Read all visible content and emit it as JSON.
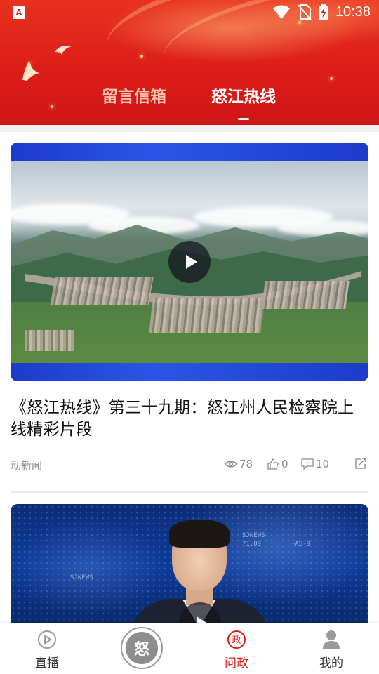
{
  "status_bar": {
    "app_badge": "A",
    "time": "10:38",
    "icons": [
      "wifi-icon",
      "no-sim-icon",
      "battery-charging-icon"
    ]
  },
  "tabs": [
    {
      "label": "留言信箱",
      "active": false
    },
    {
      "label": "怒江热线",
      "active": true
    }
  ],
  "feed": {
    "items": [
      {
        "title": "《怒江热线》第三十九期：怒江州人民检察院上线精彩片段",
        "source": "动新闻",
        "views": "78",
        "likes": "0",
        "comments": "10",
        "icons": [
          "eye-icon",
          "thumbs-up-icon",
          "comment-icon",
          "share-icon"
        ],
        "has_play_button": true
      },
      {
        "has_play_button": true,
        "overlay_texts": [
          "SJNEWS",
          "-AS-9",
          "71.09",
          "SJNEWS"
        ]
      }
    ]
  },
  "bottom_nav": {
    "items": [
      {
        "label": "直播",
        "icon": "play-circle-icon",
        "active": false
      },
      {
        "label": "",
        "icon": "center-logo",
        "glyph": "怒",
        "active": false
      },
      {
        "label": "问政",
        "icon": "zheng-badge-icon",
        "glyph": "政",
        "active": true
      },
      {
        "label": "我的",
        "icon": "user-icon",
        "active": false
      }
    ]
  },
  "colors": {
    "brand_red": "#d8201d",
    "header_red": "#dc1e1a",
    "video_band_blue": "#1d3fd4",
    "muted_text": "#8a8a8a"
  }
}
